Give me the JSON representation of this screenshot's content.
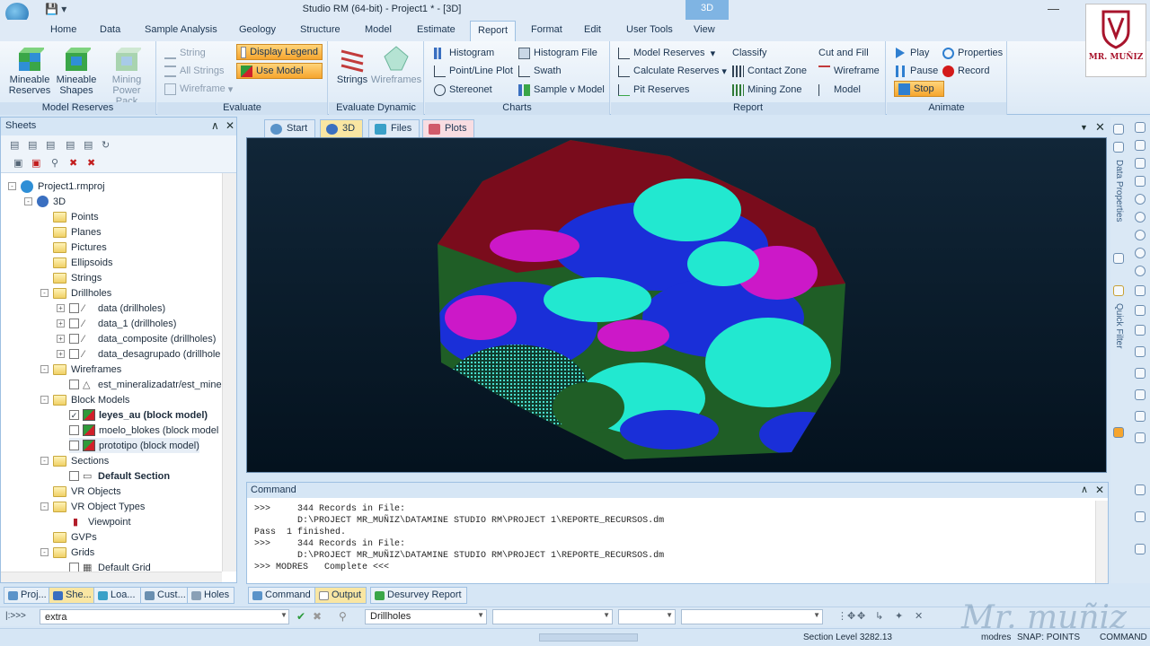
{
  "window": {
    "title": "Studio RM (64-bit) - Project1 * - [3D]",
    "context_tab": "3D",
    "minimize_glyph": "—"
  },
  "logo_badge": {
    "text": "MR. MUÑIZ"
  },
  "ribbon_tabs": [
    "Home",
    "Data",
    "Sample Analysis",
    "Geology",
    "Structure",
    "Model",
    "Estimate",
    "Report",
    "Format",
    "Edit",
    "User Tools",
    "View"
  ],
  "active_tab": "Report",
  "ribbon": {
    "model_reserves": {
      "label": "Model Reserves",
      "mineable_reserves": "Mineable Reserves",
      "mineable_shapes": "Mineable Shapes",
      "mining_power_pack": "Mining Power Pack"
    },
    "evaluate": {
      "label": "Evaluate",
      "string": "String",
      "all_strings": "All Strings",
      "wireframe": "Wireframe",
      "display_legend": "Display Legend",
      "use_model": "Use Model"
    },
    "evaluate_dynamic": {
      "label": "Evaluate Dynamic",
      "strings": "Strings",
      "wireframes": "Wireframes"
    },
    "charts": {
      "label": "Charts",
      "histogram": "Histogram",
      "point_line_plot": "Point/Line Plot",
      "stereonet": "Stereonet",
      "histogram_file": "Histogram File",
      "swath": "Swath",
      "sample_v_model": "Sample v Model"
    },
    "report": {
      "label": "Report",
      "model_reserves": "Model Reserves",
      "calculate_reserves": "Calculate Reserves",
      "pit_reserves": "Pit Reserves",
      "classify": "Classify",
      "contact_zone": "Contact Zone",
      "mining_zone": "Mining Zone",
      "cut_and_fill": "Cut and Fill",
      "wireframe": "Wireframe",
      "model": "Model"
    },
    "animate": {
      "label": "Animate",
      "play": "Play",
      "pause": "Pause",
      "stop": "Stop",
      "properties": "Properties",
      "record": "Record"
    }
  },
  "sheets": {
    "title": "Sheets",
    "tree": [
      {
        "label": "Project1.rmproj",
        "kind": "project"
      },
      {
        "label": "3D",
        "kind": "globe"
      },
      {
        "label": "Points",
        "kind": "folder"
      },
      {
        "label": "Planes",
        "kind": "folder"
      },
      {
        "label": "Pictures",
        "kind": "folder"
      },
      {
        "label": "Ellipsoids",
        "kind": "folder"
      },
      {
        "label": "Strings",
        "kind": "folder"
      },
      {
        "label": "Drillholes",
        "kind": "folder"
      },
      {
        "label": "data (drillholes)",
        "kind": "drillhole"
      },
      {
        "label": "data_1 (drillholes)",
        "kind": "drillhole"
      },
      {
        "label": "data_composite (drillholes)",
        "kind": "drillhole"
      },
      {
        "label": "data_desagrupado (drillhole",
        "kind": "drillhole"
      },
      {
        "label": "Wireframes",
        "kind": "folder"
      },
      {
        "label": "est_mineralizadatr/est_mine",
        "kind": "wireframe"
      },
      {
        "label": "Block Models",
        "kind": "folder"
      },
      {
        "label": "leyes_au (block model)",
        "kind": "blockmodel"
      },
      {
        "label": "moelo_blokes (block model",
        "kind": "blockmodel"
      },
      {
        "label": "prototipo (block model)",
        "kind": "blockmodel"
      },
      {
        "label": "Sections",
        "kind": "folder"
      },
      {
        "label": "Default Section",
        "kind": "section"
      },
      {
        "label": "VR Objects",
        "kind": "folder"
      },
      {
        "label": "VR Object Types",
        "kind": "folder"
      },
      {
        "label": "Viewpoint",
        "kind": "viewpoint"
      },
      {
        "label": "GVPs",
        "kind": "folder"
      },
      {
        "label": "Grids",
        "kind": "folder"
      },
      {
        "label": "Default Grid",
        "kind": "grid"
      }
    ]
  },
  "doc_tabs": [
    "Start",
    "3D",
    "Files",
    "Plots"
  ],
  "active_doc_tab": "3D",
  "command": {
    "title": "Command",
    "lines": [
      ">>>     344 Records in File:",
      "        D:\\PROJECT MR_MUÑIZ\\DATAMINE STUDIO RM\\PROJECT 1\\REPORTE_RECURSOS.dm",
      "Pass  1 finished.",
      ">>>     344 Records in File:",
      "        D:\\PROJECT MR_MUÑIZ\\DATAMINE STUDIO RM\\PROJECT 1\\REPORTE_RECURSOS.dm",
      ">>> MODRES   Complete <<<"
    ]
  },
  "bottom_tabs": {
    "left": [
      "Proj...",
      "She...",
      "Loa...",
      "Cust...",
      "Holes"
    ],
    "right": [
      "Command",
      "Output",
      "Desurvey Report"
    ]
  },
  "command_bar": {
    "prompt": "|:>>>",
    "input_value": "extra",
    "object_combo": "Drillholes"
  },
  "right_bar": {
    "data_properties": "Data Properties",
    "quick_filter": "Quick Filter"
  },
  "status": {
    "section_level": "Section Level 3282.13",
    "user": "modres",
    "snap": "SNAP: POINTS",
    "mode": "COMMAND"
  },
  "watermark": "Mr. muñiz",
  "colors": {
    "ore_cyan": "#22e8d0",
    "ore_magenta": "#cc18c8",
    "ore_blue": "#1a2fd8",
    "ore_green": "#1f5e26",
    "ore_maroon": "#7a0c1c",
    "highlight": "#f6a52e"
  }
}
